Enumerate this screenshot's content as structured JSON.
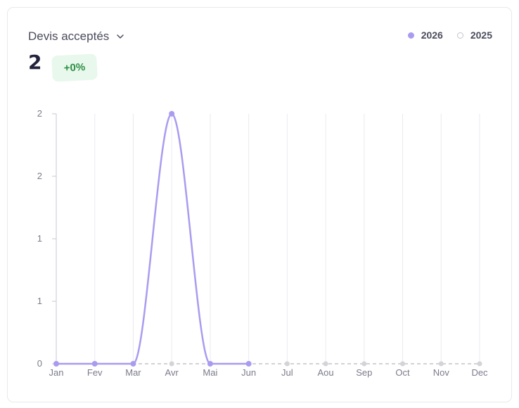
{
  "header": {
    "metric_label": "Devis acceptés",
    "total_value": "2",
    "delta_badge": "+0%"
  },
  "legend": {
    "items": [
      {
        "label": "2026",
        "color": "#a99cf0",
        "filled": true
      },
      {
        "label": "2025",
        "color": "#cfcfd6",
        "filled": false
      }
    ]
  },
  "colors": {
    "series_current": "#a99cf0",
    "series_previous": "#d3d3d8",
    "gridline": "#ebebef",
    "axis": "#c9c9d0",
    "badge_text": "#2f8f46",
    "badge_bg": "#e8f8ec"
  },
  "icons": {
    "dropdown": "chevron-down-icon"
  },
  "chart_data": {
    "type": "line",
    "title": "",
    "xlabel": "",
    "ylabel": "",
    "categories": [
      "Jan",
      "Fev",
      "Mar",
      "Avr",
      "Mai",
      "Jun",
      "Jul",
      "Aou",
      "Sep",
      "Oct",
      "Nov",
      "Dec"
    ],
    "ylim": [
      0,
      2
    ],
    "ytick_values": [
      0,
      0.5,
      1,
      1.5,
      2
    ],
    "ytick_labels": [
      "0",
      "1",
      "1",
      "2",
      "2"
    ],
    "grid": "vertical",
    "legend_position": "top-right",
    "series": [
      {
        "name": "2026",
        "values": [
          0,
          0,
          0,
          2,
          0,
          0
        ],
        "style": "smooth-solid"
      },
      {
        "name": "2025",
        "values": [
          0,
          0,
          0,
          0,
          0,
          0,
          0,
          0,
          0,
          0,
          0,
          0
        ],
        "style": "dashed"
      }
    ]
  }
}
